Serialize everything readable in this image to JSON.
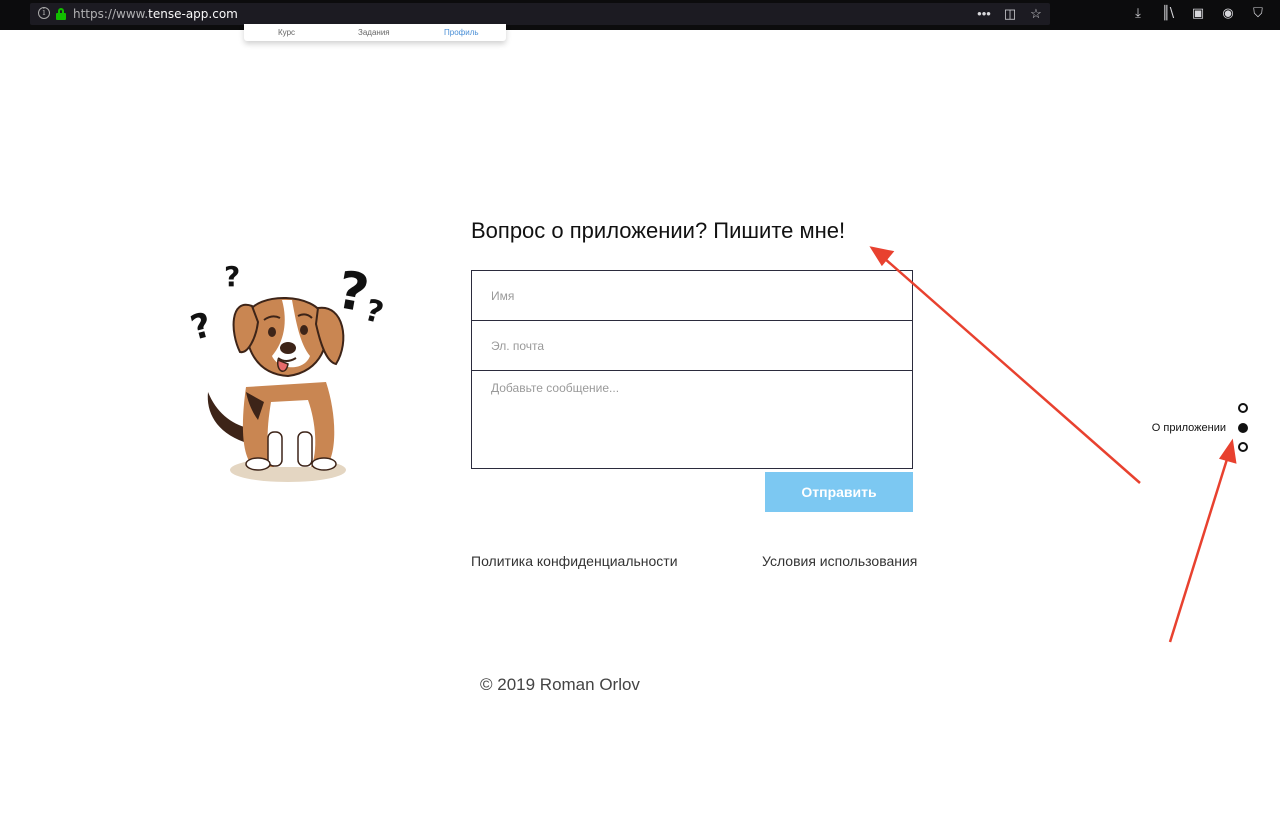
{
  "browser": {
    "url_prefix": "https://www.",
    "url_domain": "tense-app.com",
    "icons": [
      "info-icon",
      "lock-icon",
      "more-icon",
      "pocket-icon",
      "bookmark-star-icon",
      "download-icon",
      "library-icon",
      "sidebar-icon",
      "account-icon",
      "shield-icon"
    ]
  },
  "tabbar": {
    "tabs": [
      "Курс",
      "Задания",
      "Профиль"
    ]
  },
  "contact": {
    "heading": "Вопрос о приложении? Пишите мне!",
    "name_placeholder": "Имя",
    "email_placeholder": "Эл. почта",
    "message_placeholder": "Добавьте сообщение...",
    "submit_label": "Отправить"
  },
  "footer": {
    "privacy": "Политика конфиденциальности",
    "terms": "Условия использования",
    "copyright": "© 2019 Roman Orlov"
  },
  "sidenav": {
    "active_label": "О приложении",
    "active_index": 1
  },
  "colors": {
    "submit_bg": "#7cc8f2",
    "annotation_arrow": "#e8412f",
    "active_tab": "#4a8fd6"
  }
}
